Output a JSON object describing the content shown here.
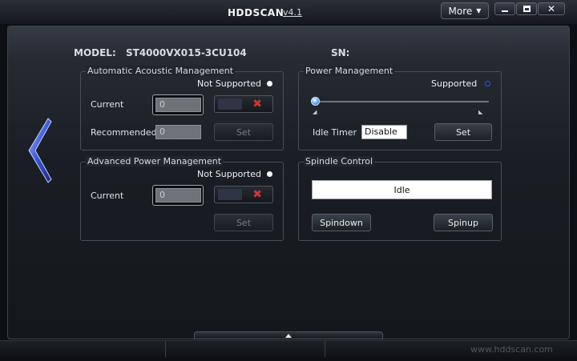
{
  "titlebar": {
    "title": "HDDSCAN",
    "version": "v4.1",
    "more_label": "More"
  },
  "header": {
    "model_label": "MODEL:",
    "model_value": "ST4000VX015-3CU104",
    "sn_label": "SN:"
  },
  "aam": {
    "title": "Automatic Acoustic Management",
    "status": "Not Supported",
    "current_label": "Current",
    "current_value": "0",
    "recommended_label": "Recommended",
    "recommended_value": "0",
    "set_label": "Set"
  },
  "apm": {
    "title": "Advanced Power Management",
    "status": "Not Supported",
    "current_label": "Current",
    "current_value": "0",
    "set_label": "Set"
  },
  "power": {
    "title": "Power Management",
    "status": "Supported",
    "slider_level": 0,
    "idle_timer_label": "Idle Timer",
    "idle_timer_value": "Disable",
    "set_label": "Set"
  },
  "spindle": {
    "title": "Spindle Control",
    "state": "Idle",
    "spindown_label": "Spindown",
    "spinup_label": "Spinup"
  },
  "footer": {
    "website": "www.hddscan.com"
  },
  "colors": {
    "not_supported_dot": "#ffffff",
    "supported_dot": "#16205a",
    "accent_blue": "#3a56d8",
    "clear_red": "#d2342f"
  },
  "icons": {
    "back": "back-arrow-icon",
    "more": "chevron-down-icon",
    "minimize": "minimize-icon",
    "maximize": "maximize-icon",
    "close": "close-icon",
    "clear": "clear-x-icon",
    "expand": "chevron-up-icon"
  }
}
